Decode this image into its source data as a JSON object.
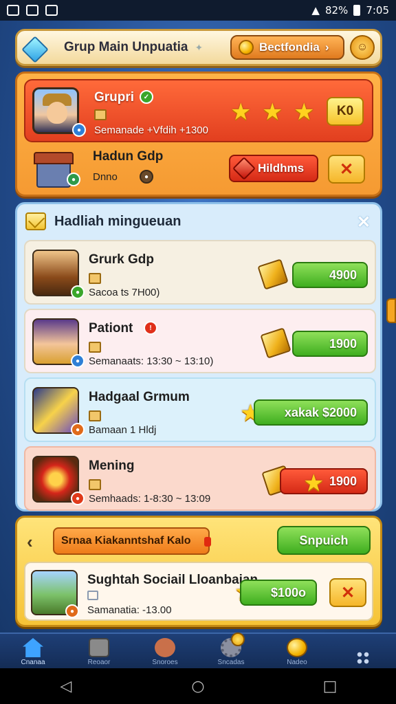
{
  "status_bar": {
    "battery": "82%",
    "time": "7:05"
  },
  "header": {
    "title": "Grup Main Unpuatia",
    "button_label": "Bectfondia",
    "button_arrow": "›"
  },
  "top_panel": {
    "row1": {
      "name": "Grupri",
      "subtitle": "Semanade +Vfdih +1300",
      "stars": 3,
      "button_label": "K0"
    },
    "row2": {
      "name": "Hadun Gdp",
      "subtitle": "Dnno",
      "button_label": "Hildhms"
    }
  },
  "weekly": {
    "title": "Hadliah mingueuan",
    "rows": [
      {
        "name": "Grurk Gdp",
        "subtitle": "Sacoa ts 7H00)",
        "amount": "4900",
        "style": "green"
      },
      {
        "name": "Pationt",
        "subtitle": "Semanaats: 13:30 ~ 13:10)",
        "amount": "1900",
        "style": "green"
      },
      {
        "name": "Hadgaal Grmum",
        "subtitle": "Bamaan 1 Hldj",
        "amount": "xakak $2000",
        "style": "green"
      },
      {
        "name": "Mening",
        "subtitle": "Semhaads: 1-8:30 ~ 13:09",
        "amount": "1900",
        "style": "red"
      }
    ]
  },
  "gold_panel": {
    "banner": "Srnaa Kiakanntshaf Kalo",
    "button_label": "Snpuich",
    "social": {
      "name": "Sughtah Sociail Lloanbaian",
      "subtitle": "Samanatia: -13.00",
      "amount": "$100o"
    }
  },
  "bottom_nav": [
    {
      "label": "Cnanaa",
      "icon": "home-icon"
    },
    {
      "label": "Reoaor",
      "icon": "dice-icon"
    },
    {
      "label": "Snoroes",
      "icon": "chat-icon"
    },
    {
      "label": "Sncadas",
      "icon": "gear-icon"
    },
    {
      "label": "Nadeo",
      "icon": "coin-icon"
    },
    {
      "label": "",
      "icon": "grid-icon"
    }
  ],
  "android_nav": {
    "back": "◁",
    "home": "○",
    "recent": "□"
  }
}
